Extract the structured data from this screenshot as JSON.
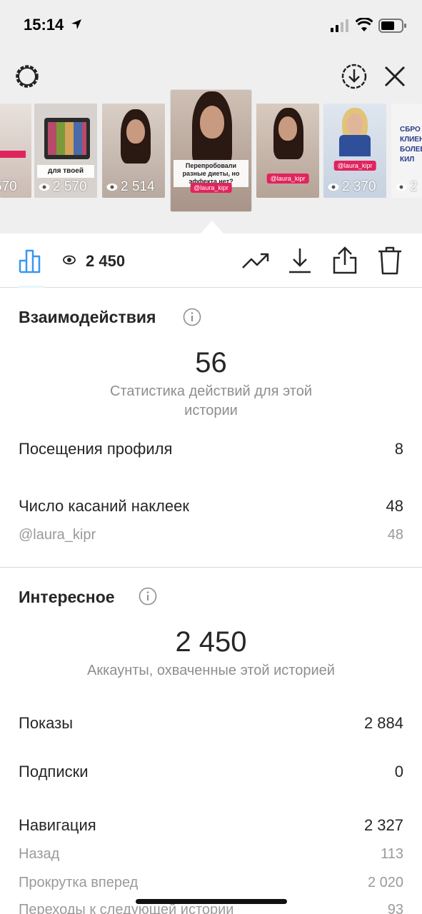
{
  "status_bar": {
    "time": "15:14"
  },
  "stories": [
    {
      "views": "570",
      "caption": "",
      "tag": ""
    },
    {
      "views": "2 570",
      "caption": "для твоей",
      "tag": ""
    },
    {
      "views": "2 514",
      "caption": "",
      "tag": ""
    },
    {
      "views": "",
      "caption": "Перепробовали разные диеты, но эффекта нет?",
      "tag": "@laura_kipr"
    },
    {
      "views": "",
      "caption": "",
      "tag": "@laura_kipr"
    },
    {
      "views": "2 370",
      "caption": "",
      "tag": "@laura_kipr"
    },
    {
      "views": "2",
      "caption": "СБРО КЛИЕН БОЛЕЕ КИЛ",
      "tag": ""
    }
  ],
  "toolbar": {
    "views": "2 450"
  },
  "interactions": {
    "title": "Взаимодействия",
    "total": "56",
    "caption": "Статистика действий для этой истории",
    "rows": [
      {
        "label": "Посещения профиля",
        "value": "8"
      },
      {
        "label": "Число касаний наклеек",
        "value": "48"
      }
    ],
    "sub_rows": [
      {
        "label": "@laura_kipr",
        "value": "48"
      }
    ]
  },
  "discovery": {
    "title": "Интересное",
    "total": "2 450",
    "caption": "Аккаунты, охваченные этой историей",
    "rows": [
      {
        "label": "Показы",
        "value": "2 884"
      },
      {
        "label": "Подписки",
        "value": "0"
      },
      {
        "label": "Навигация",
        "value": "2 327"
      }
    ],
    "sub_rows": [
      {
        "label": "Назад",
        "value": "113"
      },
      {
        "label": "Прокрутка вперед",
        "value": "2 020"
      },
      {
        "label": "Переходы к следующей истории",
        "value": "93"
      }
    ]
  }
}
